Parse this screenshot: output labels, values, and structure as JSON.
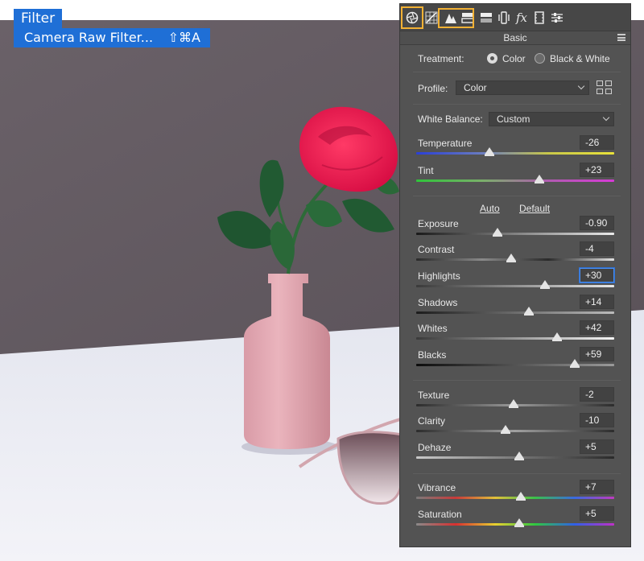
{
  "menu": {
    "title": "Filter",
    "item_label": "Camera Raw Filter...",
    "item_shortcut": "⇧⌘A"
  },
  "panel": {
    "section_title": "Basic",
    "toolbar_icons": [
      "aperture-icon",
      "tone-curve-icon",
      "detail-icon",
      "hsl-icon",
      "split-toning-icon",
      "lens-corrections-icon",
      "fx-icon",
      "camera-calibration-icon",
      "presets-icon"
    ],
    "fx_glyph": "fx",
    "treatment": {
      "label": "Treatment:",
      "options": [
        "Color",
        "Black & White"
      ],
      "selected": "Color"
    },
    "profile": {
      "label": "Profile:",
      "value": "Color"
    },
    "white_balance": {
      "label": "White Balance:",
      "value": "Custom"
    },
    "auto_label": "Auto",
    "default_label": "Default",
    "sliders": {
      "temperature": {
        "label": "Temperature",
        "value": "-26",
        "position": 0.37
      },
      "tint": {
        "label": "Tint",
        "value": "+23",
        "position": 0.62
      },
      "exposure": {
        "label": "Exposure",
        "value": "-0.90",
        "position": 0.41
      },
      "contrast": {
        "label": "Contrast",
        "value": "-4",
        "position": 0.48
      },
      "highlights": {
        "label": "Highlights",
        "value": "+30",
        "position": 0.65
      },
      "shadows": {
        "label": "Shadows",
        "value": "+14",
        "position": 0.57
      },
      "whites": {
        "label": "Whites",
        "value": "+42",
        "position": 0.71
      },
      "blacks": {
        "label": "Blacks",
        "value": "+59",
        "position": 0.8
      },
      "texture": {
        "label": "Texture",
        "value": "-2",
        "position": 0.49
      },
      "clarity": {
        "label": "Clarity",
        "value": "-10",
        "position": 0.45
      },
      "dehaze": {
        "label": "Dehaze",
        "value": "+5",
        "position": 0.52
      },
      "vibrance": {
        "label": "Vibrance",
        "value": "+7",
        "position": 0.53
      },
      "saturation": {
        "label": "Saturation",
        "value": "+5",
        "position": 0.52
      }
    }
  }
}
